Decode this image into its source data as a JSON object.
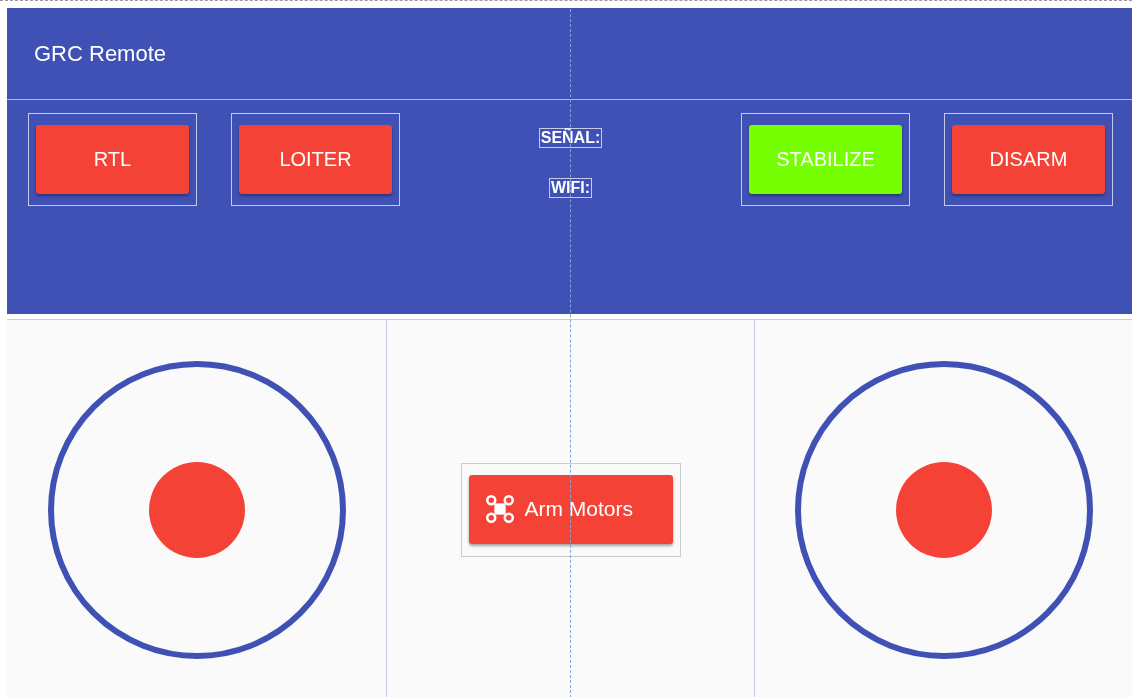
{
  "app_bar": {
    "title": "GRC Remote"
  },
  "modes_left": [
    {
      "label": "RTL",
      "selected": false
    },
    {
      "label": "LOITER",
      "selected": false
    }
  ],
  "status": [
    {
      "label": "SEÑAL:"
    },
    {
      "label": "WIFI:"
    }
  ],
  "modes_right": [
    {
      "label": "STABILIZE",
      "selected": true
    },
    {
      "label": "DISARM",
      "selected": false
    }
  ],
  "arm_button": {
    "label": "Arm Motors"
  }
}
